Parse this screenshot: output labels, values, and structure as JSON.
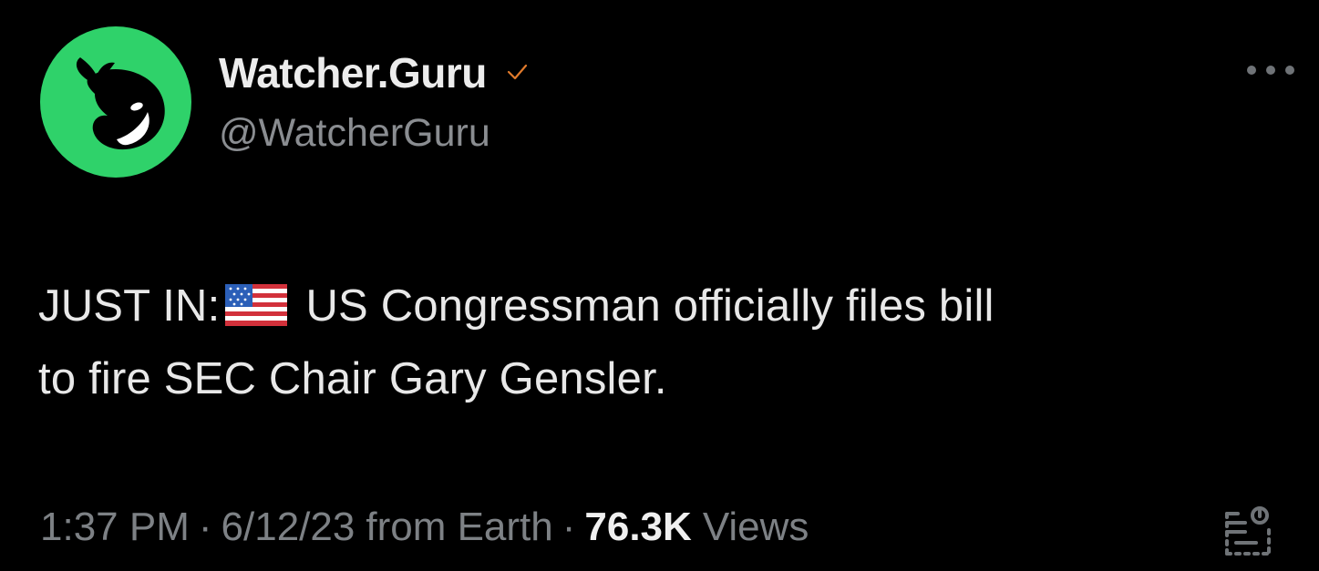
{
  "author": {
    "display_name": "Watcher.Guru",
    "handle": "@WatcherGuru",
    "avatar_icon": "orca-whale-icon",
    "avatar_color": "#2fd26a",
    "verified_color": "#e07a2b"
  },
  "tweet": {
    "text_prefix": "JUST IN:",
    "flag_icon": "us-flag-icon",
    "text_line1_rest": "US Congressman officially files bill",
    "text_line2": "to fire SEC Chair Gary Gensler."
  },
  "meta": {
    "time": "1:37 PM",
    "separator": "·",
    "date": "6/12/23",
    "source": "from Earth",
    "views_count": "76.3K",
    "views_label": "Views"
  },
  "icons": {
    "more": "more-options-icon",
    "analytics": "analytics-icon"
  }
}
